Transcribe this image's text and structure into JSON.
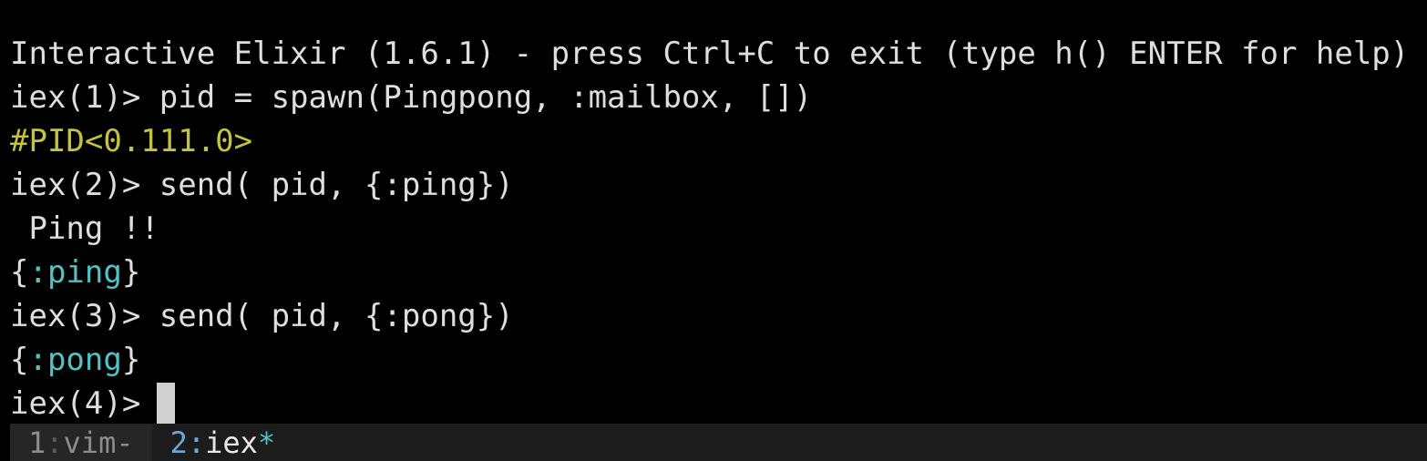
{
  "terminal": {
    "lines": [
      {
        "text": "Interactive Elixir (1.6.1) - press Ctrl+C to exit (type h() ENTER for help)"
      },
      {
        "prompt": "iex(1)>",
        "command": " pid = spawn(Pingpong, :mailbox, [])"
      },
      {
        "text": "#PID<0.111.0>"
      },
      {
        "prompt": "iex(2)>",
        "command": " send( pid, {:ping})"
      },
      {
        "text": " Ping !!"
      },
      {
        "open": "{",
        "value": ":ping",
        "close": "}"
      },
      {
        "prompt": "iex(3)>",
        "command": " send( pid, {:pong})"
      },
      {
        "open": "{",
        "value": ":pong",
        "close": "}"
      },
      {
        "prompt": "iex(4)>"
      }
    ]
  },
  "status_bar": {
    "windows": [
      {
        "index": "1",
        "separator": ":",
        "name": "vim-",
        "flag": ""
      },
      {
        "index": "2",
        "separator": ":",
        "name": "iex",
        "flag": "*"
      }
    ]
  },
  "colors": {
    "background": "#000000",
    "text": "#dedede",
    "pid": "#c5c23b",
    "atom": "#4ec3c8",
    "active_window_index": "#6aa8d8"
  }
}
